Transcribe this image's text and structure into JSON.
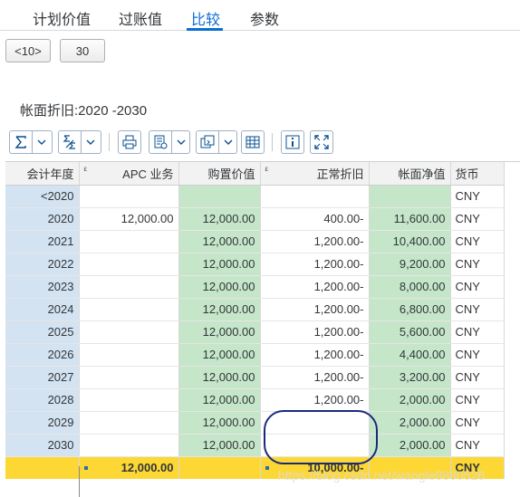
{
  "tabs": [
    {
      "label": "计划价值"
    },
    {
      "label": "过账值"
    },
    {
      "label": "比较"
    },
    {
      "label": "参数"
    }
  ],
  "nav": {
    "prev_label": "<10>",
    "next_label": "30"
  },
  "section_title": "帐面折旧:2020 -2030",
  "table": {
    "headers": {
      "year": "会计年度",
      "apc": "APC 业务",
      "purchase": "购置价值",
      "dep": "正常折旧",
      "book": "帐面净值",
      "cur": "货币"
    },
    "sigma_marker": "ε",
    "rows": [
      {
        "year": "<2020",
        "apc": "",
        "purchase": "",
        "dep": "",
        "book": "",
        "cur": "CNY"
      },
      {
        "year": "2020",
        "apc": "12,000.00",
        "purchase": "12,000.00",
        "dep": "400.00-",
        "book": "11,600.00",
        "cur": "CNY"
      },
      {
        "year": "2021",
        "apc": "",
        "purchase": "12,000.00",
        "dep": "1,200.00-",
        "book": "10,400.00",
        "cur": "CNY"
      },
      {
        "year": "2022",
        "apc": "",
        "purchase": "12,000.00",
        "dep": "1,200.00-",
        "book": "9,200.00",
        "cur": "CNY"
      },
      {
        "year": "2023",
        "apc": "",
        "purchase": "12,000.00",
        "dep": "1,200.00-",
        "book": "8,000.00",
        "cur": "CNY"
      },
      {
        "year": "2024",
        "apc": "",
        "purchase": "12,000.00",
        "dep": "1,200.00-",
        "book": "6,800.00",
        "cur": "CNY"
      },
      {
        "year": "2025",
        "apc": "",
        "purchase": "12,000.00",
        "dep": "1,200.00-",
        "book": "5,600.00",
        "cur": "CNY"
      },
      {
        "year": "2026",
        "apc": "",
        "purchase": "12,000.00",
        "dep": "1,200.00-",
        "book": "4,400.00",
        "cur": "CNY"
      },
      {
        "year": "2027",
        "apc": "",
        "purchase": "12,000.00",
        "dep": "1,200.00-",
        "book": "3,200.00",
        "cur": "CNY"
      },
      {
        "year": "2028",
        "apc": "",
        "purchase": "12,000.00",
        "dep": "1,200.00-",
        "book": "2,000.00",
        "cur": "CNY"
      },
      {
        "year": "2029",
        "apc": "",
        "purchase": "12,000.00",
        "dep": "",
        "book": "2,000.00",
        "cur": "CNY"
      },
      {
        "year": "2030",
        "apc": "",
        "purchase": "12,000.00",
        "dep": "",
        "book": "2,000.00",
        "cur": "CNY"
      }
    ],
    "total": {
      "apc": "12,000.00",
      "dep": "10,000.00-",
      "cur": "CNY"
    }
  },
  "watermark": "https://blog.csdn.net/wangle8880526",
  "colors": {
    "accent": "#0a6ed1",
    "year_col": "#d4e3f1",
    "value_col": "#c5e6c9",
    "total_row": "#fdd835",
    "annotation": "#1a2a7a"
  },
  "toolbar_icons": [
    "sum-icon",
    "dropdown-icon",
    "subtotal-icon",
    "dropdown-icon",
    "print-icon",
    "export-icon",
    "dropdown-icon",
    "layout-icon",
    "dropdown-icon",
    "grid-icon",
    "info-icon",
    "fullscreen-icon"
  ]
}
